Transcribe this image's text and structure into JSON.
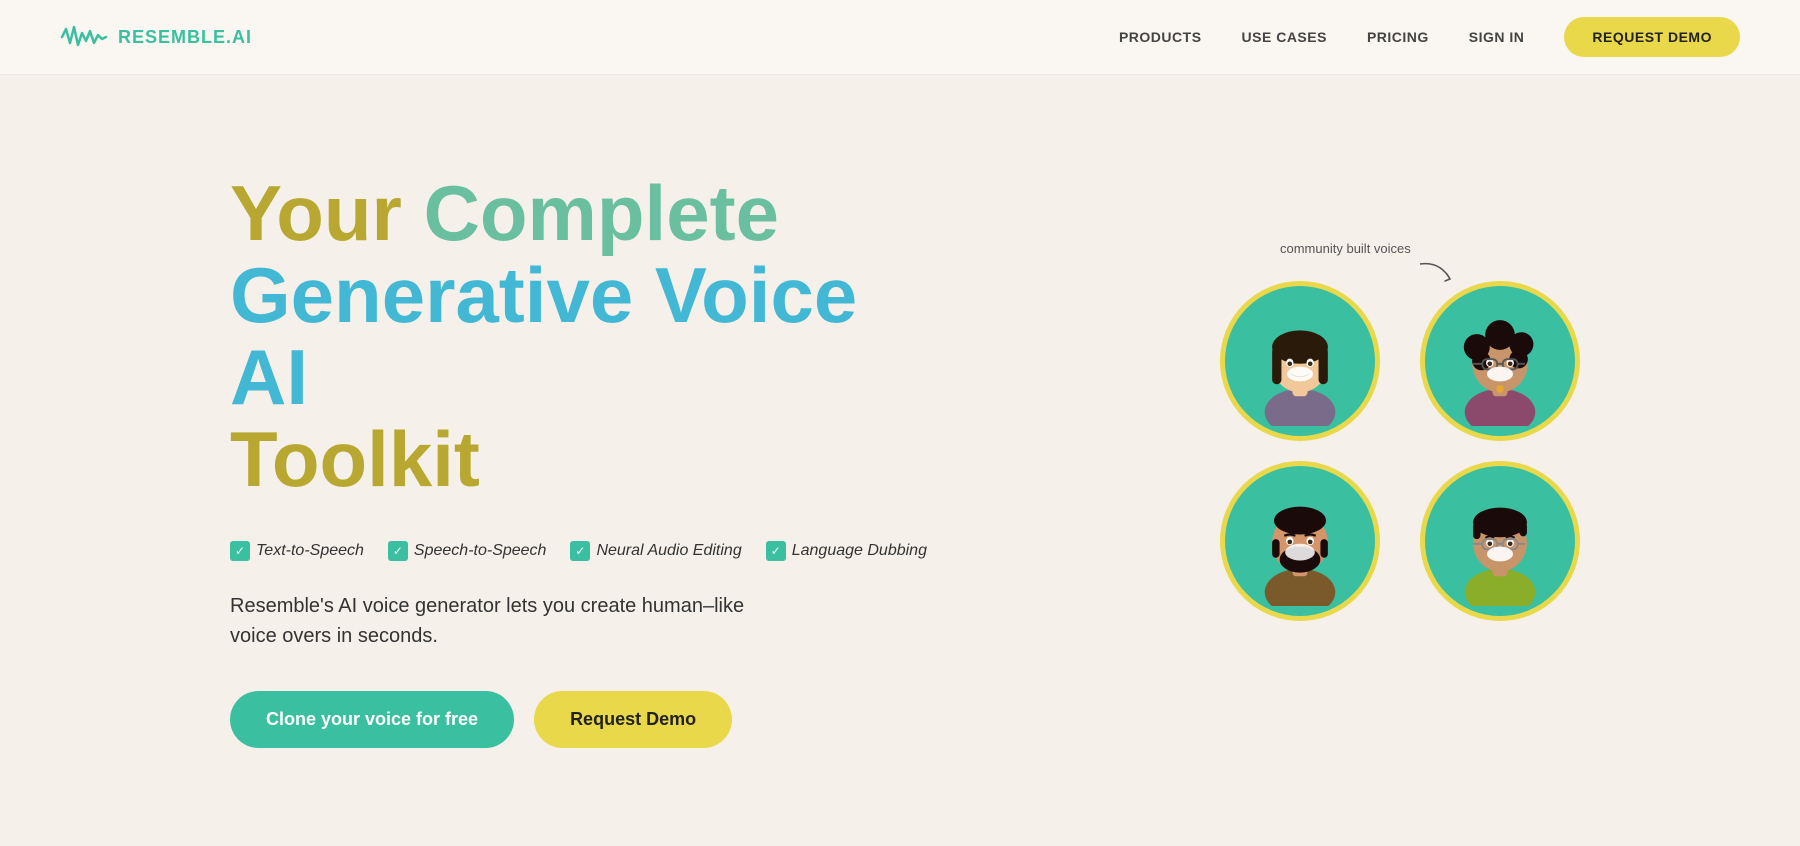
{
  "navbar": {
    "logo_text": "RESEMBLE.AI",
    "nav_items": [
      {
        "label": "PRODUCTS",
        "id": "products"
      },
      {
        "label": "USE CASES",
        "id": "use-cases"
      },
      {
        "label": "PRICING",
        "id": "pricing"
      },
      {
        "label": "SIGN IN",
        "id": "sign-in"
      }
    ],
    "cta_button": "REQUEST DEMO"
  },
  "hero": {
    "title_part1": "Your Complete",
    "title_part2": "Generative Voice AI",
    "title_part3": "Toolkit",
    "features": [
      "Text-to-Speech",
      "Speech-to-Speech",
      "Neural Audio Editing",
      "Language Dubbing"
    ],
    "description": "Resemble's AI voice generator lets you create human–like voice overs in seconds.",
    "clone_btn": "Clone your voice for free",
    "demo_btn": "Request Demo",
    "community_label": "community built voices"
  },
  "colors": {
    "teal": "#3abfa0",
    "yellow": "#e8d84a",
    "gold": "#b8a832",
    "light_teal": "#6abfa0",
    "blue": "#42b8d4",
    "bg": "#f5f0ea"
  }
}
